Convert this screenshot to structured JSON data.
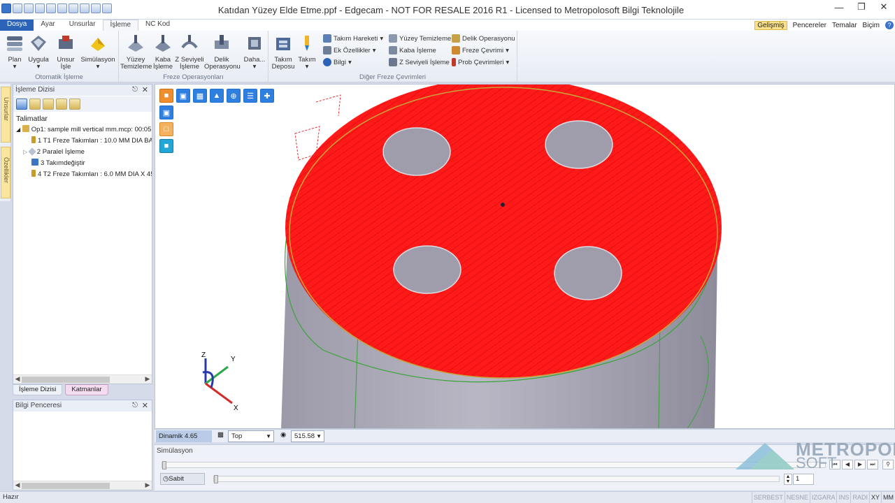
{
  "window": {
    "title": "Katıdan Yüzey Elde Etme.ppf - Edgecam - NOT FOR RESALE 2016 R1  - Licensed to Metropolosoft Bilgi Teknolojile"
  },
  "tabs": [
    "Dosya",
    "Ayar",
    "Unsurlar",
    "İşleme",
    "NC Kod"
  ],
  "active_tab": "İşleme",
  "tabs_right": {
    "gelismis": "Gelişmiş",
    "pencereler": "Pencereler",
    "temalar": "Temalar",
    "bicim": "Biçim"
  },
  "ribbon": {
    "groups": {
      "otomatik": "Otomatik İşleme",
      "freze": "Freze Operasyonları",
      "diger": "Diğer Freze Çevrimleri"
    },
    "buttons": {
      "plan": "Plan",
      "uygula": "Uygula",
      "unsur_1": "Unsur",
      "unsur_2": "İşle",
      "simulasyon": "Simülasyon",
      "yuzey_1": "Yüzey",
      "yuzey_2": "Temizleme",
      "kaba_1": "Kaba",
      "kaba_2": "İşleme",
      "zsev_1": "Z Seviyeli",
      "zsev_2": "İşleme",
      "delik_1": "Delik",
      "delik_2": "Operasyonu",
      "daha": "Daha...",
      "takim_deposu_1": "Takım",
      "takim_deposu_2": "Deposu",
      "takim": "Takım"
    },
    "small": {
      "takim_hareketi": "Takım Hareketi",
      "ek_ozellikler": "Ek Özellikler",
      "bilgi": "Bilgi",
      "yuzey_temizleme": "Yüzey Temizleme",
      "kaba_isleme": "Kaba İşleme",
      "z_seviyeli_isleme": "Z Seviyeli İşleme",
      "delik_operasyonu": "Delik Operasyonu",
      "freze_cevrimi": "Freze Çevrimi",
      "prob_cevrimleri": "Prob Çevrimleri"
    }
  },
  "side_tabs": {
    "unsurlar": "Unsurlar",
    "ozellikler": "Özellikler"
  },
  "isleme_dizisi": {
    "title": "İşleme Dizisi",
    "root": "Talimatlar",
    "items": [
      "Op1: sample mill vertical mm.mcp: 00:05:",
      "1 T1 Freze Takımları : 10.0 MM DIA BA",
      "2 Paralel İşleme",
      "3 Takımdeğiştir",
      "4 T2 Freze Takımları : 6.0 MM DIA X 45"
    ]
  },
  "bottom_tabs": {
    "isleme_dizisi": "İşleme Dizisi",
    "katmanlar": "Katmanlar"
  },
  "bilgi_penceresi": {
    "title": "Bilgi Penceresi"
  },
  "view_status": {
    "dinamik": "Dinamik 4.65",
    "view": "Top",
    "zoom": "515.58"
  },
  "simulation": {
    "title": "Simülasyon",
    "sabit": "Sabit",
    "step_value": "1"
  },
  "status": {
    "left": "Hazır",
    "modes": [
      "SERBEST",
      "NESNE",
      "IZGARA",
      "INS",
      "RADI",
      "XY",
      "MM"
    ],
    "active_modes": [
      "XY",
      "MM"
    ]
  },
  "axes": {
    "x": "X",
    "y": "Y",
    "z": "Z"
  },
  "logo": {
    "line1": "METROPOL",
    "line2": "SOFT"
  },
  "colors": {
    "accent": "#2b63b8",
    "toolpath": "#ff1a1a",
    "part": "#a9a7b5"
  }
}
